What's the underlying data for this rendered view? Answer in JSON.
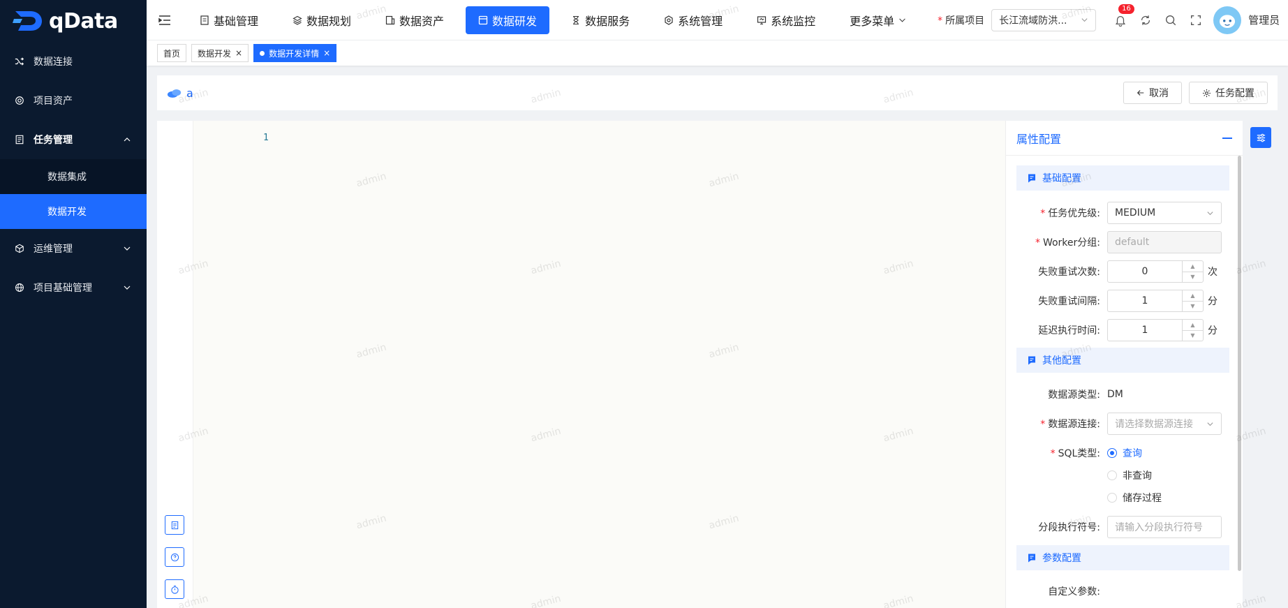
{
  "app": {
    "logo_text": "qData"
  },
  "sidebar": {
    "items": [
      {
        "label": "数据连接",
        "icon": "shuffle-icon"
      },
      {
        "label": "项目资产",
        "icon": "asset-icon"
      },
      {
        "label": "任务管理",
        "icon": "document-icon",
        "expanded": true,
        "children": [
          {
            "label": "数据集成"
          },
          {
            "label": "数据开发",
            "active": true
          }
        ]
      },
      {
        "label": "运维管理",
        "icon": "cube-icon"
      },
      {
        "label": "项目基础管理",
        "icon": "globe-icon"
      }
    ]
  },
  "topnav": {
    "menu": [
      {
        "label": "基础管理"
      },
      {
        "label": "数据规划"
      },
      {
        "label": "数据资产"
      },
      {
        "label": "数据研发",
        "active": true
      },
      {
        "label": "数据服务"
      },
      {
        "label": "系统管理"
      },
      {
        "label": "系统监控"
      },
      {
        "label": "更多菜单"
      }
    ],
    "project_label": "所属项目",
    "project_value": "长江流域防洪...",
    "notifications": "16",
    "user": "管理员"
  },
  "tabs": [
    {
      "label": "首页"
    },
    {
      "label": "数据开发"
    },
    {
      "label": "数据开发详情",
      "active": true
    }
  ],
  "toolbar": {
    "title": "a",
    "cancel": "取消",
    "task_config": "任务配置"
  },
  "editor": {
    "line_number": "1"
  },
  "panel": {
    "title": "属性配置",
    "sections": {
      "basic": "基础配置",
      "other": "其他配置",
      "params": "参数配置"
    },
    "priority": {
      "label": "任务优先级:",
      "value": "MEDIUM"
    },
    "worker": {
      "label": "Worker分组:",
      "value": "default"
    },
    "retry_times": {
      "label": "失败重试次数:",
      "value": "0",
      "unit": "次"
    },
    "retry_interval": {
      "label": "失败重试间隔:",
      "value": "1",
      "unit": "分"
    },
    "delay": {
      "label": "延迟执行时间:",
      "value": "1",
      "unit": "分"
    },
    "ds_type": {
      "label": "数据源类型:",
      "value": "DM"
    },
    "ds_conn": {
      "label": "数据源连接:",
      "placeholder": "请选择数据源连接"
    },
    "sql_type": {
      "label": "SQL类型:",
      "options": [
        "查询",
        "非查询",
        "储存过程"
      ],
      "selected": "查询"
    },
    "segment": {
      "label": "分段执行符号:",
      "placeholder": "请输入分段执行符号"
    },
    "custom_params": {
      "label": "自定义参数:"
    }
  },
  "watermark": "admin",
  "colors": {
    "primary": "#1e6bff",
    "sidebar_bg": "#0b1a2f",
    "required": "#f5222d"
  }
}
